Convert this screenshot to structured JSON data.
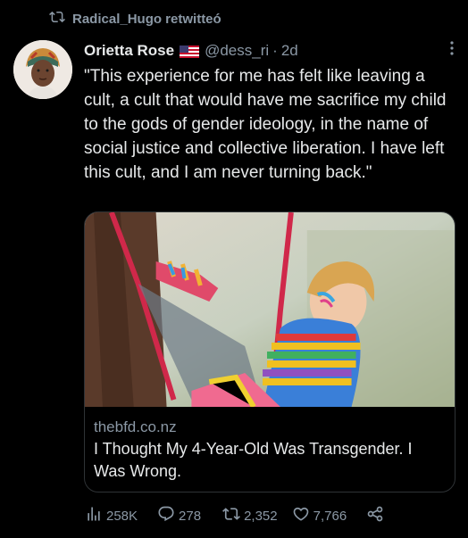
{
  "retweet": {
    "label": "Radical_Hugo retwitteó",
    "icon": "retweet-icon"
  },
  "tweet": {
    "author_name": "Orietta Rose",
    "author_flag": "us-flag-icon",
    "handle": "@dess_ri",
    "separator": "·",
    "time": "2d",
    "text": "\"This experience for me has felt like leaving a cult, a cult that would have me sacrifice my child to the gods of gender ideology, in the name of social justice and collective liberation. I have left this cult, and I am never turning back.\""
  },
  "card": {
    "domain": "thebfd.co.nz",
    "title": "I Thought My 4-Year-Old Was Transgender. I Was Wrong."
  },
  "actions": {
    "views": "258K",
    "replies": "278",
    "retweets": "2,352",
    "likes": "7,766"
  },
  "colors": {
    "background": "#000000",
    "text": "#e7e9ea",
    "muted": "#8b98a5",
    "border": "#2f3336"
  }
}
